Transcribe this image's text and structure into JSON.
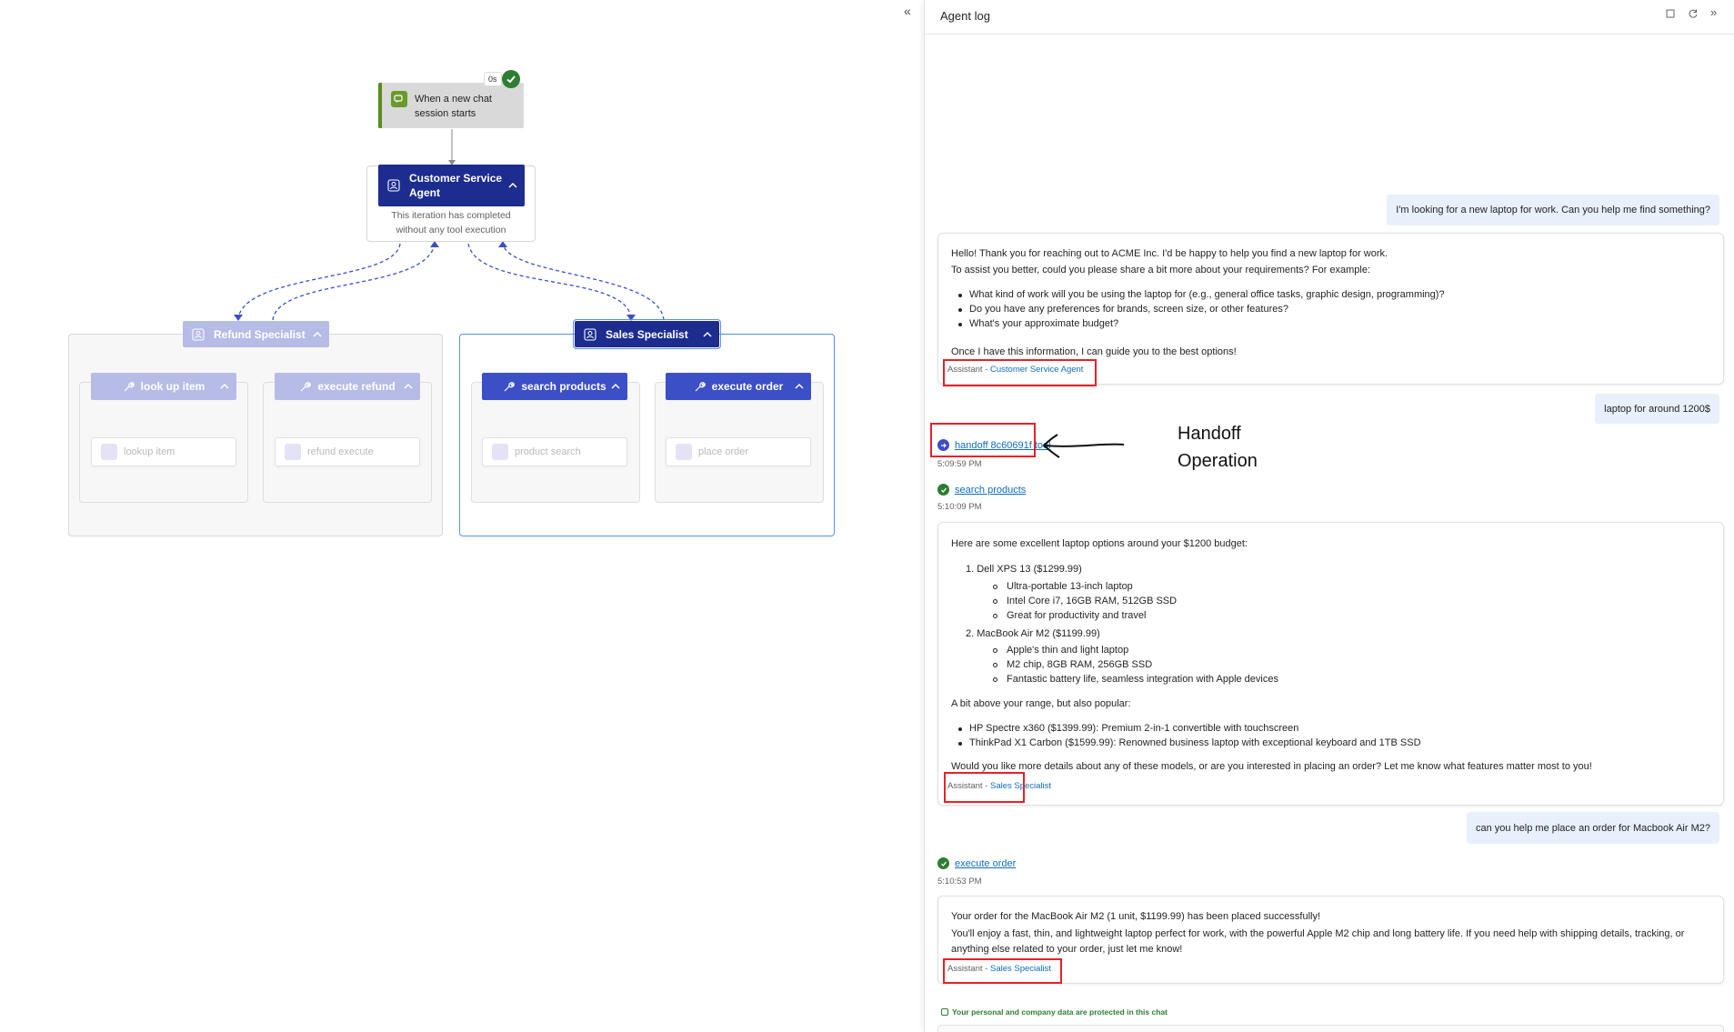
{
  "trigger": {
    "label_line1": "When a new chat",
    "label_line2": "session starts",
    "duration": "0s"
  },
  "main_agent": {
    "title_line1": "Customer Service",
    "title_line2": "Agent",
    "status_line1": "This iteration has completed",
    "status_line2": "without any tool execution"
  },
  "refund_group": {
    "title": "Refund Specialist",
    "tools": [
      {
        "label": "look up item",
        "card": "lookup item"
      },
      {
        "label": "execute refund",
        "card": "refund execute"
      }
    ]
  },
  "sales_group": {
    "title": "Sales Specialist",
    "tools": [
      {
        "label": "search products",
        "card": "product search"
      },
      {
        "label": "execute order",
        "card": "place order"
      }
    ]
  },
  "panel": {
    "title": "Agent log"
  },
  "annotation": {
    "line1": "Handoff",
    "line2": "Operation"
  },
  "messages": {
    "u1": "I'm looking for a new laptop for work. Can you help me find something?",
    "a1": {
      "p1": "Hello! Thank you for reaching out to ACME Inc. I'd be happy to help you find a new laptop for work.",
      "p2": "To assist you better, could you please share a bit more about your requirements? For example:",
      "bullets": [
        "What kind of work will you be using the laptop for (e.g., general office tasks, graphic design, programming)?",
        "Do you have any preferences for brands, screen size, or other features?",
        "What's your approximate budget?"
      ],
      "p3": "Once I have this information, I can guide you to the best options!",
      "sig_prefix": "Assistant - ",
      "sig_name": "Customer Service Agent"
    },
    "u2": "laptop for around 1200$",
    "handoff": {
      "label": "handoff 8c60691f tool",
      "time": "5:09:59 PM"
    },
    "search": {
      "label": "search products",
      "time": "5:10:09 PM"
    },
    "a2": {
      "intro": "Here are some excellent laptop options around your $1200 budget:",
      "item1": "1. Dell XPS 13 ($1299.99)",
      "item1_subs": [
        "Ultra-portable 13-inch laptop",
        "Intel Core i7, 16GB RAM, 512GB SSD",
        "Great for productivity and travel"
      ],
      "item2": "2. MacBook Air M2 ($1199.99)",
      "item2_subs": [
        "Apple's thin and light laptop",
        "M2 chip, 8GB RAM, 256GB SSD",
        "Fantastic battery life, seamless integration with Apple devices"
      ],
      "above": "A bit above your range, but also popular:",
      "above_items": [
        "HP Spectre x360 ($1399.99): Premium 2-in-1 convertible with touchscreen",
        "ThinkPad X1 Carbon ($1599.99): Renowned business laptop with exceptional keyboard and 1TB SSD"
      ],
      "outro": "Would you like more details about any of these models, or are you interested in placing an order? Let me know what features matter most to you!",
      "sig_prefix": "Assistant - ",
      "sig_name": "Sales Specialist"
    },
    "u3": "can you help me place an order for Macbook Air M2?",
    "order": {
      "label": "execute order",
      "time": "5:10:53 PM"
    },
    "a3": {
      "p1": "Your order for the MacBook Air M2 (1 unit, $1199.99) has been placed successfully!",
      "p2": "You'll enjoy a fast, thin, and lightweight laptop perfect for work, with the powerful Apple M2 chip and long battery life. If you need help with shipping details, tracking, or",
      "p3": "anything else related to your order, just let me know!",
      "sig_prefix": "Assistant - ",
      "sig_name": "Sales Specialist"
    },
    "privacy": "Your personal and company data are protected in this chat"
  },
  "colors": {
    "navy": "#1c2d8f",
    "blue": "#3c4fc6",
    "faded": "#b7bce6",
    "success": "#2e7d32",
    "link": "#0f6cbd",
    "annotation_red": "#e8202a"
  }
}
